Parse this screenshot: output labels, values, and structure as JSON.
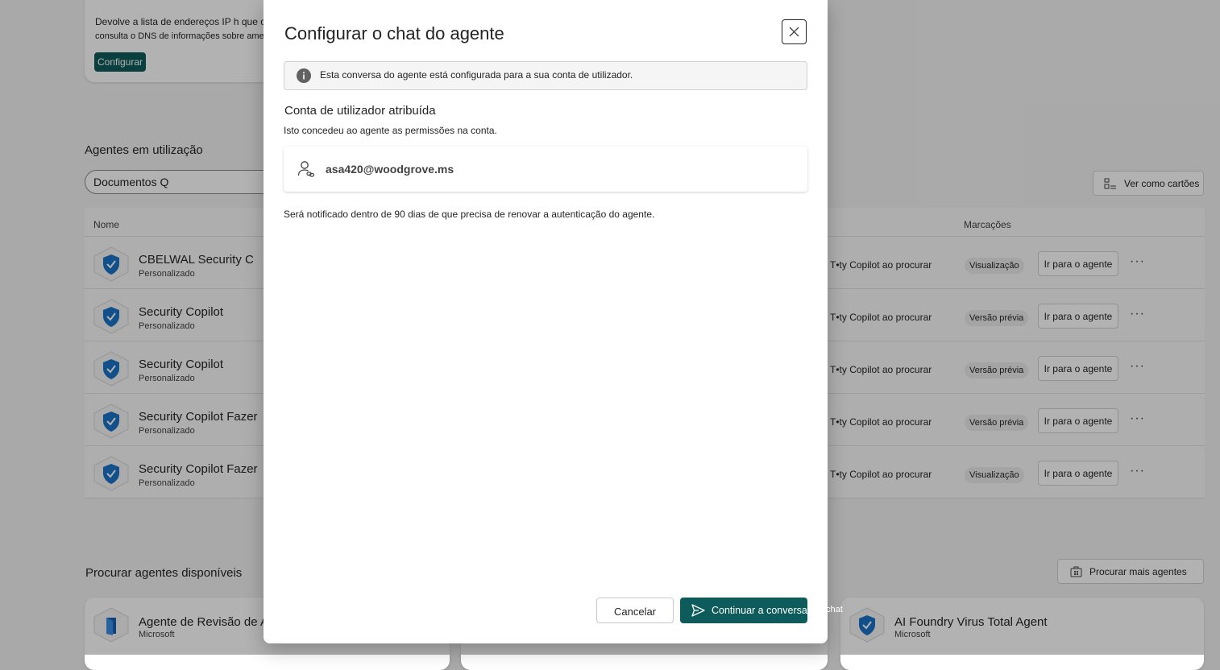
{
  "background": {
    "top_card": {
      "description_line1": "Devolve a lista de endereços IP h que o",
      "description_line2": "consulta o DNS de informações sobre ameaças",
      "configure_label": "Configurar"
    },
    "agents_in_use": {
      "title": "Agentes em utilização",
      "search_value": "Documentos Q",
      "view_as_cards_label": "Ver como cartões",
      "columns": {
        "name": "Nome",
        "tags": "Marcações"
      },
      "rows": [
        {
          "name": "CBELWAL Security C",
          "sub": "Personalizado",
          "provider": "T•ty Copilot ao procurar",
          "tag": "Visualização",
          "action": "Ir para o agente"
        },
        {
          "name": "Security Copilot",
          "sub": "Personalizado",
          "provider": "T•ty Copilot ao procurar",
          "tag": "Versão prévia",
          "action": "Ir para o agente"
        },
        {
          "name": "Security Copilot",
          "sub": "Personalizado",
          "provider": "T•ty Copilot ao procurar",
          "tag": "Versão prévia",
          "action": "Ir para o agente"
        },
        {
          "name": "Security Copilot Fazer",
          "sub": "Personalizado",
          "provider": "T•ty Copilot ao procurar",
          "tag": "Versão prévia",
          "action": "Ir para o agente"
        },
        {
          "name": "Security Copilot Fazer",
          "sub": "Personalizado",
          "provider": "T•ty Copilot ao procurar",
          "tag": "Visualização",
          "action": "Ir para o agente"
        }
      ],
      "more_icon": "ellipsis-icon"
    },
    "browse_agents": {
      "title": "Procurar agentes disponíveis",
      "browse_more_label": "Procurar mais agentes",
      "cards": [
        {
          "name": "Agente de Revisão de Acesso",
          "sub": "Microsoft"
        },
        {
          "name": "AI Foundry Virus Total Agent",
          "sub": "Microsoft"
        }
      ]
    }
  },
  "dialog": {
    "title": "Configurar o chat do agente",
    "info_text": "Esta conversa do agente está configurada para a sua conta de utilizador.",
    "assigned_account_heading": "Conta de utilizador atribuída",
    "assigned_account_description": "Isto concedeu ao agente as permissões na conta.",
    "account_email": "asa420@woodgrove.ms",
    "renewal_notice": "Será notificado dentro de 90 dias de que precisa de renovar a autenticação do agente.",
    "cancel_label": "Cancelar",
    "continue_label": "Continuar a conversar",
    "continue_overflow": "chat"
  },
  "colors": {
    "accent": "#0e5b5b",
    "shield": "#1a73c8"
  }
}
